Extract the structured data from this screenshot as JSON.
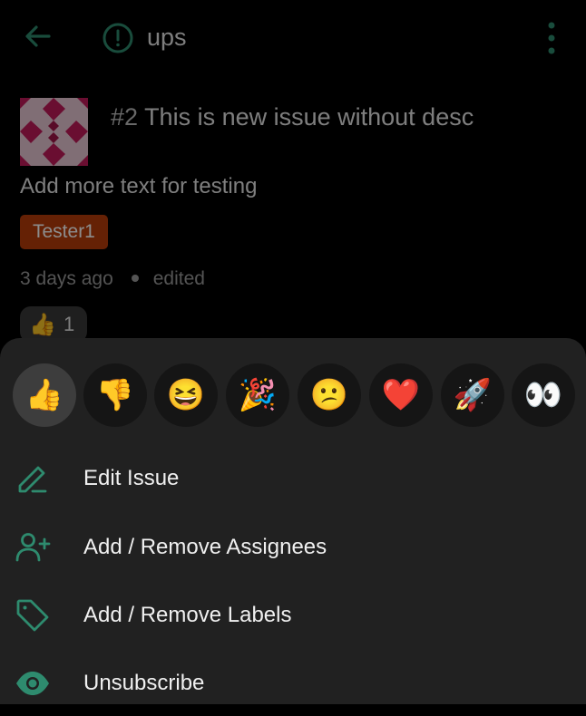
{
  "header": {
    "title": "ups"
  },
  "issue": {
    "number": "#2",
    "title": "This is new issue without desc",
    "description": "Add more text for testing",
    "label": "Tester1",
    "time": "3 days ago",
    "edited": "edited",
    "reaction": {
      "emoji": "👍",
      "count": "1"
    }
  },
  "reactions": [
    {
      "name": "thumbs-up",
      "emoji": "👍"
    },
    {
      "name": "thumbs-down",
      "emoji": "👎"
    },
    {
      "name": "laugh",
      "emoji": "😆"
    },
    {
      "name": "hooray",
      "emoji": "🎉"
    },
    {
      "name": "confused",
      "emoji": "😕"
    },
    {
      "name": "heart",
      "emoji": "❤️"
    },
    {
      "name": "rocket",
      "emoji": "🚀"
    },
    {
      "name": "eyes",
      "emoji": "👀"
    }
  ],
  "menu": {
    "edit": "Edit Issue",
    "assignees": "Add / Remove Assignees",
    "labels": "Add / Remove Labels",
    "subscribe": "Unsubscribe"
  },
  "colors": {
    "accent": "#2e8b6e",
    "sheet": "#212121",
    "label": "#b83c0a"
  }
}
